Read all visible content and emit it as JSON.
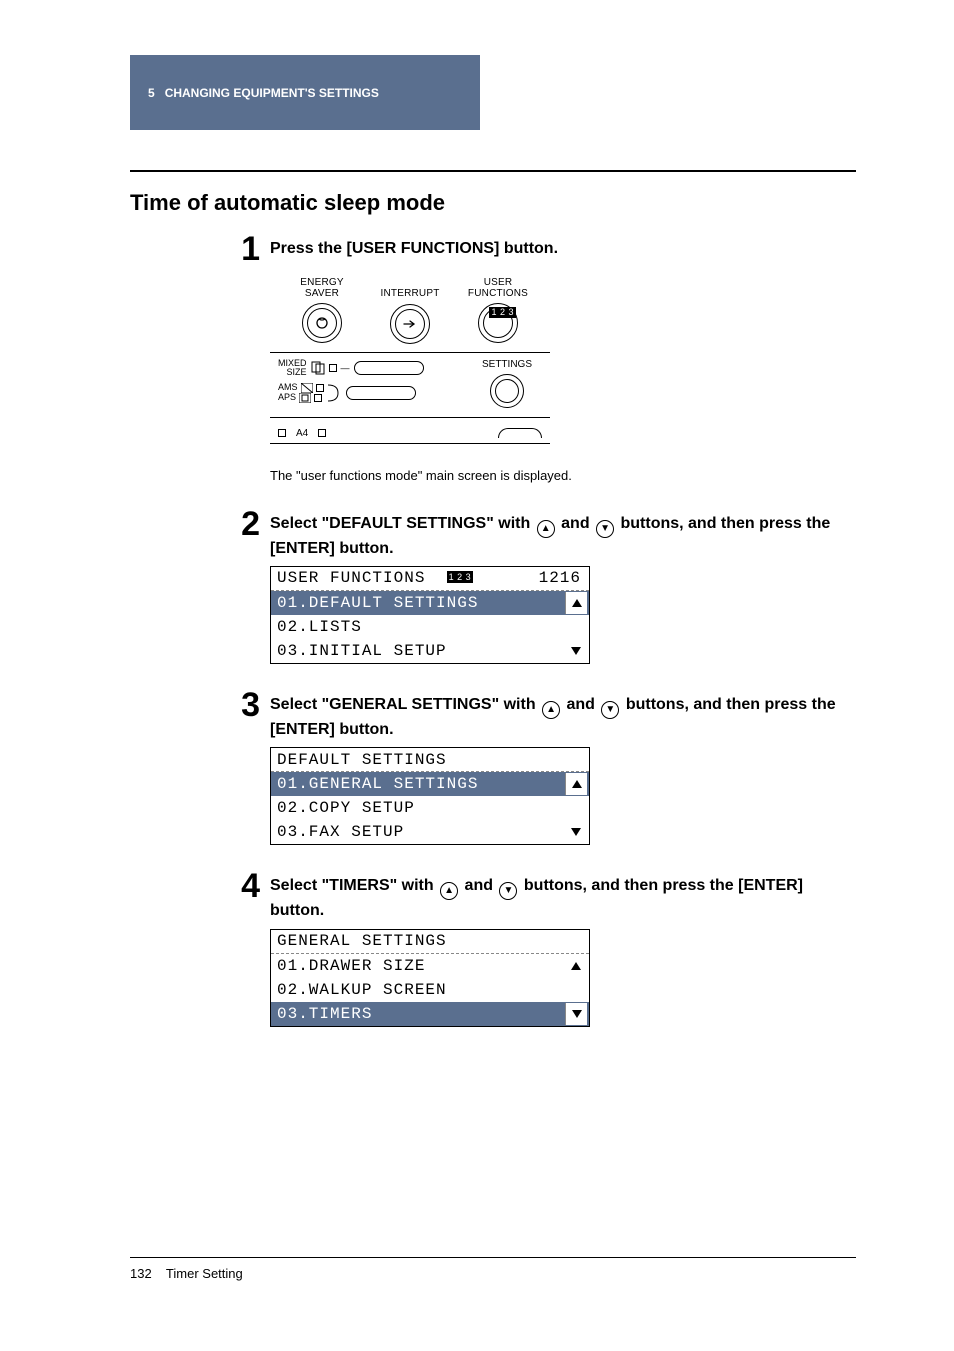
{
  "header": {
    "chapter_num": "5",
    "chapter_title": "CHANGING EQUIPMENT'S SETTINGS"
  },
  "section_title": "Time of automatic sleep mode",
  "steps": [
    {
      "num": "1",
      "text_plain": "Press the [USER FUNCTIONS] button.",
      "caption": "The \"user functions mode\" main screen is displayed."
    },
    {
      "num": "2",
      "text_before": "Select \"DEFAULT SETTINGS\" with ",
      "text_mid": " and ",
      "text_after": " buttons, and then press the [ENTER] button."
    },
    {
      "num": "3",
      "text_before": "Select \"GENERAL SETTINGS\" with ",
      "text_mid": " and ",
      "text_after": " buttons, and then press the [ENTER] button."
    },
    {
      "num": "4",
      "text_before": "Select \"TIMERS\" with ",
      "text_mid": " and ",
      "text_after": " buttons, and then press the [ENTER] button."
    }
  ],
  "panel": {
    "energy_saver": "ENERGY\nSAVER",
    "interrupt": "INTERRUPT",
    "user_functions": "USER\nFUNCTIONS",
    "mixed_size": "MIXED\nSIZE",
    "ams": "AMS",
    "aps": "APS",
    "settings": "SETTINGS",
    "a4": "A4"
  },
  "lcd2": {
    "title": "USER FUNCTIONS",
    "clock": "1216",
    "rows": [
      "01.DEFAULT SETTINGS",
      "02.LISTS",
      "03.INITIAL SETUP"
    ],
    "selected_index": 0
  },
  "lcd3": {
    "title": "DEFAULT SETTINGS",
    "rows": [
      "01.GENERAL SETTINGS",
      "02.COPY SETUP",
      "03.FAX SETUP"
    ],
    "selected_index": 0
  },
  "lcd4": {
    "title": "GENERAL SETTINGS",
    "rows": [
      "01.DRAWER SIZE",
      "02.WALKUP SCREEN",
      "03.TIMERS"
    ],
    "selected_index": 2
  },
  "footer": {
    "page": "132",
    "label": "Timer Setting"
  }
}
